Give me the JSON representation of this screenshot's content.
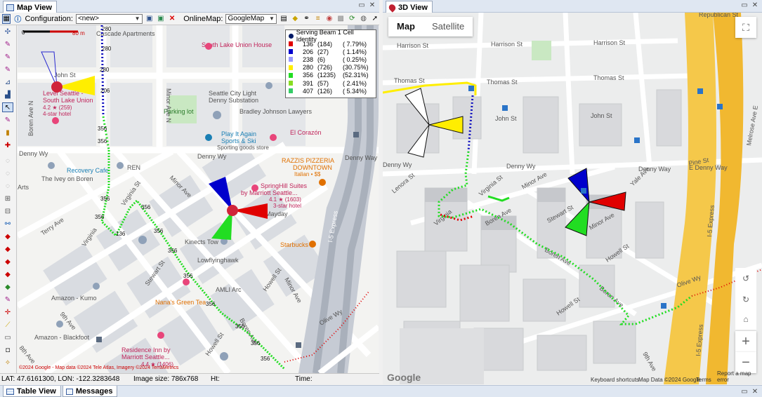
{
  "map_view": {
    "title": "Map View",
    "toolbar": {
      "configuration_label": "Configuration:",
      "configuration_value": "<new>",
      "online_map_label": "OnlineMap:",
      "online_map_value": "GoogleMap"
    },
    "scale": {
      "zero": "0",
      "label": "80 m"
    },
    "legend": {
      "title": "Serving Beam 1 Cell Identity",
      "items": [
        {
          "id": "136",
          "count": "(184)",
          "pct": "( 7.79%)",
          "color": "#e00000"
        },
        {
          "id": "206",
          "count": "(27)",
          "pct": "( 1.14%)",
          "color": "#0000cc"
        },
        {
          "id": "238",
          "count": "(6)",
          "pct": "( 0.25%)",
          "color": "#9999ff"
        },
        {
          "id": "280",
          "count": "(726)",
          "pct": "(30.75%)",
          "color": "#ffee00"
        },
        {
          "id": "356",
          "count": "(1235)",
          "pct": "(52.31%)",
          "color": "#22dd22"
        },
        {
          "id": "391",
          "count": "(57)",
          "pct": "( 2.41%)",
          "color": "#88dd22"
        },
        {
          "id": "407",
          "count": "(126)",
          "pct": "( 5.34%)",
          "color": "#33cc66"
        }
      ]
    },
    "places": {
      "cascade_apartments": "Cascade Apartments",
      "south_lake_union_house": "South Lake Union House",
      "level_seattle": "Level Seattle -",
      "level_seattle_2": "South Lake Union",
      "level_rating": "4.2 ★ (259)",
      "level_class": "4-star hotel",
      "city_light": "Seattle City Light",
      "city_light_2": "Denny Substation",
      "parking_lot": "Parking lot",
      "bradley": "Bradley Johnson Lawyers",
      "play_it_again": "Play It Again",
      "play_it_again_2": "Sports & Ski",
      "play_it_again_3": "Sporting goods store",
      "el_corazon": "El Corazón",
      "razzis": "RAZZIS PIZZERIA",
      "razzis_2": "DOWNTOWN",
      "razzis_3": "Italian • $$",
      "recovery_cafe": "Recovery Cafe",
      "ren": "REN",
      "ivey": "The Ivey on Boren",
      "springhill": "SpringHill Suites",
      "springhill_2": "by Marriott Seattle...",
      "springhill_rating": "4.1 ★ (1603)",
      "springhill_class": "3-star hotel",
      "mayday": "n - Mayday",
      "kinects": "Kinects Tow",
      "starbucks": "Starbucks",
      "lowflyinghawk": "Lowflyinghawk",
      "amli": "AMLI Arc",
      "amazon_kumo": "Amazon - Kumo",
      "nanas": "Nana's Green Tea",
      "amazon_blackfoot": "Amazon - Blackfoot",
      "residence_inn": "Residence Inn by",
      "residence_inn_2": "Marriott Seattle...",
      "residence_rating": "4.4 ★ (1406)",
      "arts": "Arts"
    },
    "streets": {
      "john_st": "John St",
      "denny_wy": "Denny Wy",
      "denny_wy_2": "Denny Way",
      "boren_ave_n": "Boren Ave N",
      "minor_ave_n": "Minor Ave N",
      "terry_ave": "Terry Ave",
      "virginia": "Virginia",
      "virginia_st": "Virginia St",
      "minor_ave": "Minor Ave",
      "stewart_st": "Stewart St",
      "ninth_ave": "9th Ave",
      "eighth_ave": "8th Ave",
      "howell_st": "Howell St",
      "howell_st_2": "Howell St",
      "boren_ave": "Boren Ave",
      "olive_wy": "Olive Wy",
      "i5_express": "I-5 Express"
    },
    "site_labels": [
      "280",
      "206",
      "356",
      "136"
    ],
    "copyright": "©2024 Google - Map data ©2024 Tele Atlas, Imagery ©2024 TerraMetrics",
    "status": {
      "latlon": "LAT: 47.6161300, LON: -122.3283648",
      "image_size": "Image size: 786x768",
      "ht": "Ht:",
      "time": "Time:"
    }
  },
  "view_3d": {
    "title": "3D View",
    "map_type": {
      "map": "Map",
      "satellite": "Satellite"
    },
    "streets": {
      "republican_st": "Republican St",
      "harrison_st": "Harrison St",
      "harrison_st_2": "Harrison St",
      "harrison_st_3": "Harrison St",
      "thomas_st": "Thomas St",
      "thomas_st_2": "Thomas St",
      "thomas_st_3": "Thomas St",
      "john_st": "John St",
      "john_st_2": "John St",
      "denny_wy": "Denny Wy",
      "denny_wy_2": "Denny Wy",
      "e_denny_way": "E Denny Way",
      "denny_way": "Denny Way",
      "virginia_st": "Virginia St",
      "lenora_st": "Lenora St",
      "boren_ave": "Boren Ave",
      "boren_ave_2": "Boren Ave",
      "minor_ave": "Minor Ave",
      "minor_ave_2": "Minor Ave",
      "yale_ave": "Yale Ave",
      "stewart_st": "Stewart St",
      "howell_st": "Howell St",
      "howell_st_2": "Howell St",
      "olive_wy": "Olive Wy",
      "i5_express": "I-5 Express",
      "i5_express_2": "I-5 Express",
      "melrose_ave_e": "Melrose Ave E",
      "pine_st": "Pine St",
      "virginia": "Virginia",
      "boren_ave_3": "Boren Ave",
      "ave_9": "9th Ave"
    },
    "footer": {
      "google": "Google",
      "keyboard": "Keyboard shortcuts",
      "map_data": "Map Data ©2024 Google",
      "terms": "Terms",
      "report": "Report a map error"
    }
  },
  "bottom_tabs": {
    "table_view": "Table View",
    "messages": "Messages"
  }
}
